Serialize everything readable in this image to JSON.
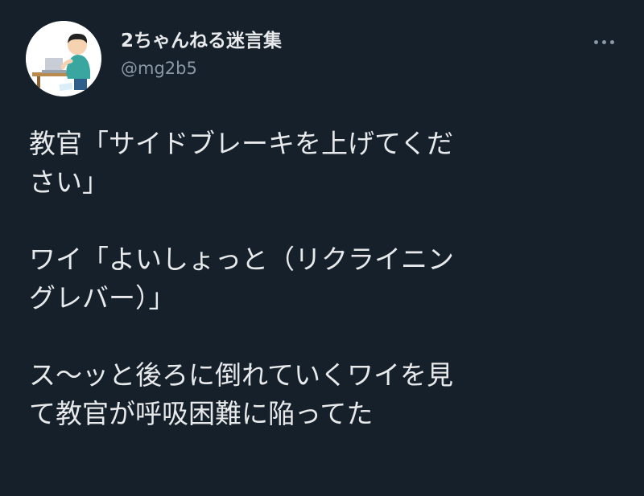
{
  "author": {
    "display_name": "2ちゃんねる迷言集",
    "handle": "@mg2b5",
    "avatar_icon": "person-at-laptop-avatar"
  },
  "menu": {
    "icon": "more-dots-icon"
  },
  "tweet": {
    "paragraphs": [
      {
        "lines": [
          "教官「サイドブレーキを上げてくだ",
          "さい」"
        ]
      },
      {
        "lines": [
          "ワイ「よいしょっと（リクライニン",
          "グレバー）」"
        ]
      },
      {
        "lines": [
          "ス〜ッと後ろに倒れていくワイを見",
          "て教官が呼吸困難に陥ってた"
        ]
      }
    ]
  },
  "colors": {
    "background": "#15202b",
    "text": "#e7e9ea",
    "secondary": "#8b98a5"
  }
}
